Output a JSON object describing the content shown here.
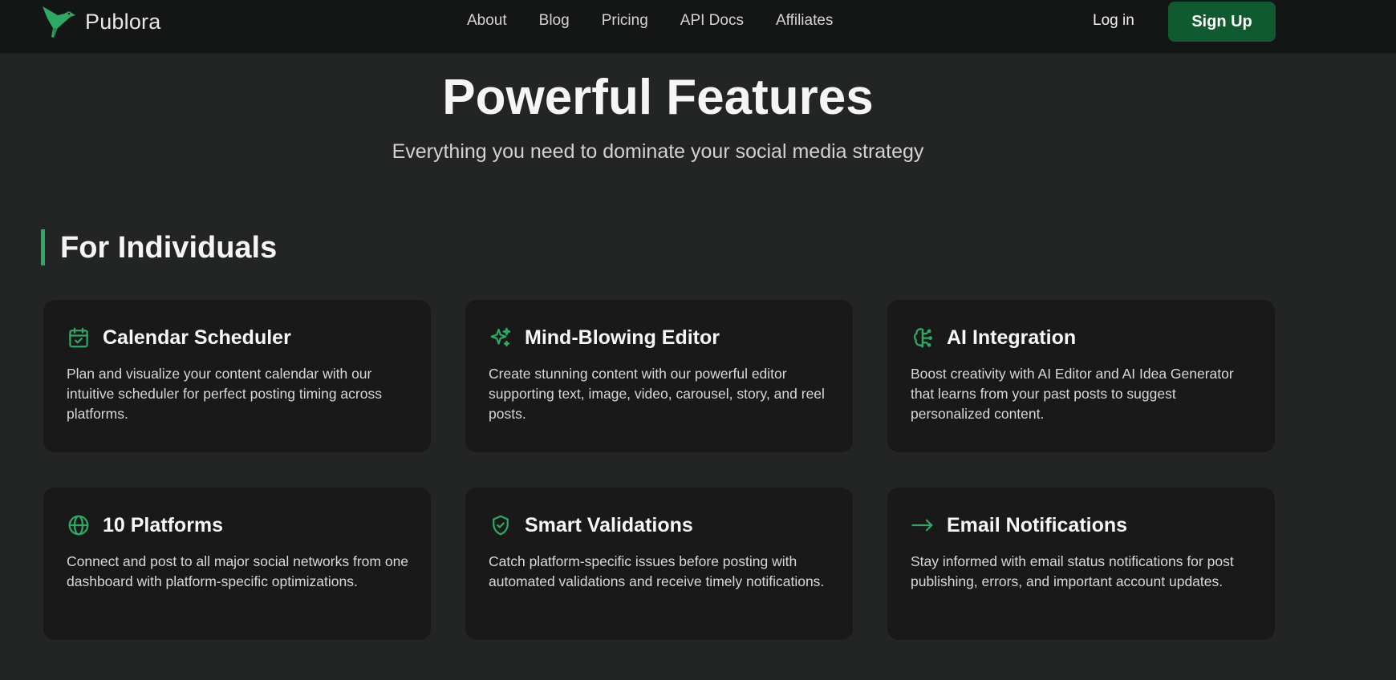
{
  "nav": {
    "brand": "Publora",
    "links": [
      "About",
      "Blog",
      "Pricing",
      "API Docs",
      "Affiliates"
    ],
    "login": "Log in",
    "signup": "Sign Up"
  },
  "hero": {
    "title": "Powerful Features",
    "subtitle": "Everything you need to dominate your social media strategy"
  },
  "section": {
    "title": "For Individuals"
  },
  "features": [
    {
      "icon": "calendar-check-icon",
      "title": "Calendar Scheduler",
      "description": "Plan and visualize your content calendar with our intuitive scheduler for perfect posting timing across platforms."
    },
    {
      "icon": "sparkles-icon",
      "title": "Mind-Blowing Editor",
      "description": "Create stunning content with our powerful editor supporting text, image, video, carousel, story, and reel posts."
    },
    {
      "icon": "brain-icon",
      "title": "AI Integration",
      "description": "Boost creativity with AI Editor and AI Idea Generator that learns from your past posts to suggest personalized content."
    },
    {
      "icon": "globe-icon",
      "title": "10 Platforms",
      "description": "Connect and post to all major social networks from one dashboard with platform-specific optimizations."
    },
    {
      "icon": "shield-check-icon",
      "title": "Smart Validations",
      "description": "Catch platform-specific issues before posting with automated validations and receive timely notifications."
    },
    {
      "icon": "arrow-right-icon",
      "title": "Email Notifications",
      "description": "Stay informed with email status notifications for post publishing, errors, and important account updates."
    }
  ],
  "colors": {
    "accent": "#2ea862",
    "signup_bg": "#0f5a2e",
    "page_bg": "#232525",
    "nav_bg": "#141515",
    "card_bg": "#19191a"
  }
}
